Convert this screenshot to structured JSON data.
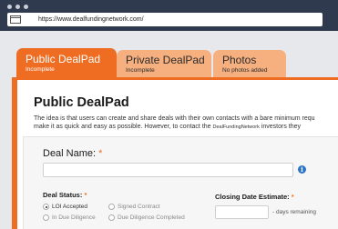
{
  "browser": {
    "url": "https://www.dealfundingnetwork.com/"
  },
  "tabs": [
    {
      "title": "Public DealPad",
      "subtitle": "Incomplete",
      "active": true
    },
    {
      "title": "Private DealPad",
      "subtitle": "Incomplete",
      "active": false
    },
    {
      "title": "Photos",
      "subtitle": "No photos added",
      "active": false
    }
  ],
  "main": {
    "title": "Public DealPad",
    "intro_line1": "The idea is that users can create and share deals with their own contacts with a bare minimum requ",
    "intro_line2_start": "make it as quick and easy as possible. However, to contact the",
    "intro_brand": "DealFundingNetwork",
    "intro_line2_end": "investors they"
  },
  "form": {
    "deal_name_label": "Deal Name:",
    "required_mark": "*",
    "deal_name_value": "",
    "info_glyph": "i",
    "deal_status_label": "Deal Status:",
    "status_options": [
      {
        "label": "LOI Accepted",
        "checked": true
      },
      {
        "label": "Signed Contract",
        "checked": false
      },
      {
        "label": "In Due Diligence",
        "checked": false
      },
      {
        "label": "Due Diligence Completed",
        "checked": false
      }
    ],
    "closing_label": "Closing Date Estimate:",
    "days_value": "",
    "days_suffix": "- days remaining"
  },
  "colors": {
    "accent": "#ee6d22",
    "tab_inactive": "#f6b07f",
    "chrome": "#2f3a4f",
    "info": "#2d74c8"
  }
}
